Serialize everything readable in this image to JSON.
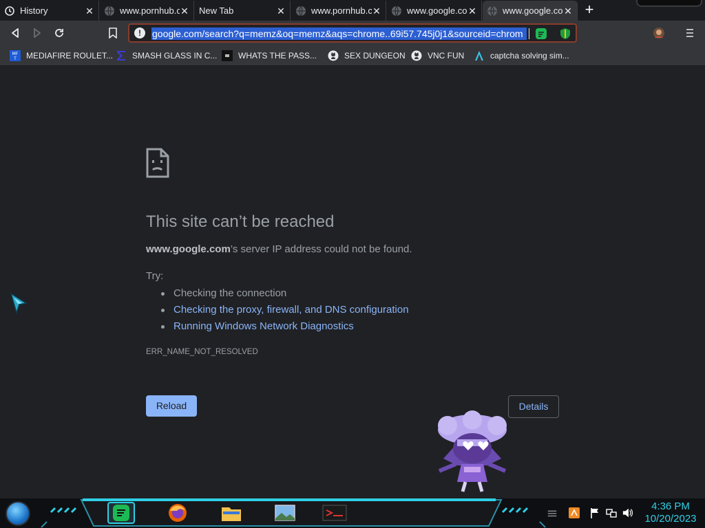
{
  "tabs": [
    {
      "title": "History",
      "icon": "history-icon",
      "active": false
    },
    {
      "title": "www.pornhub.c",
      "icon": "globe-icon",
      "active": false
    },
    {
      "title": "New Tab",
      "icon": "none",
      "active": false
    },
    {
      "title": "www.pornhub.c",
      "icon": "globe-icon",
      "active": false
    },
    {
      "title": "www.google.co",
      "icon": "globe-icon",
      "active": false
    },
    {
      "title": "www.google.co",
      "icon": "globe-icon",
      "active": true
    }
  ],
  "new_tab_glyph": "+",
  "toolbar": {
    "url": "google.com/search?q=memz&oq=memz&aqs=chrome..69i57.745j0j1&sourceid=chrom"
  },
  "bookmarks": [
    {
      "label": "MEDIAFIRE ROULET...",
      "icon": "mediafire-icon",
      "color": "#1d5bd8"
    },
    {
      "label": "SMASH GLASS IN C...",
      "icon": "sigma-icon",
      "color": "#3b3bd6"
    },
    {
      "label": "WHATS THE PASS...",
      "icon": "dark-square-icon",
      "color": "#111111"
    },
    {
      "label": "SEX DUNGEON",
      "icon": "github-icon",
      "color": "#e8eaed"
    },
    {
      "label": "VNC FUN",
      "icon": "github-icon",
      "color": "#e8eaed"
    },
    {
      "label": "captcha solving sim...",
      "icon": "lambda-icon",
      "color": "#36c7e6"
    }
  ],
  "error": {
    "title": "This site can’t be reached",
    "host": "www.google.com",
    "message_rest": "’s server IP address could not be found.",
    "try_label": "Try:",
    "suggestions": [
      {
        "text": "Checking the connection",
        "link": false
      },
      {
        "text": "Checking the proxy, firewall, and DNS configuration",
        "link": true
      },
      {
        "text": "Running Windows Network Diagnostics",
        "link": true
      }
    ],
    "code": "ERR_NAME_NOT_RESOLVED",
    "reload_label": "Reload",
    "details_label": "Details"
  },
  "taskbar": {
    "clock_time": "4:36 PM",
    "clock_date": "10/20/2023",
    "apps": [
      "spotify-icon",
      "firefox-icon",
      "file-explorer-icon",
      "photos-icon",
      "terminal-icon"
    ]
  },
  "colors": {
    "accent_link": "#8ab4f8",
    "url_selection": "#2c5fd2",
    "clock": "#2fd0e6"
  }
}
